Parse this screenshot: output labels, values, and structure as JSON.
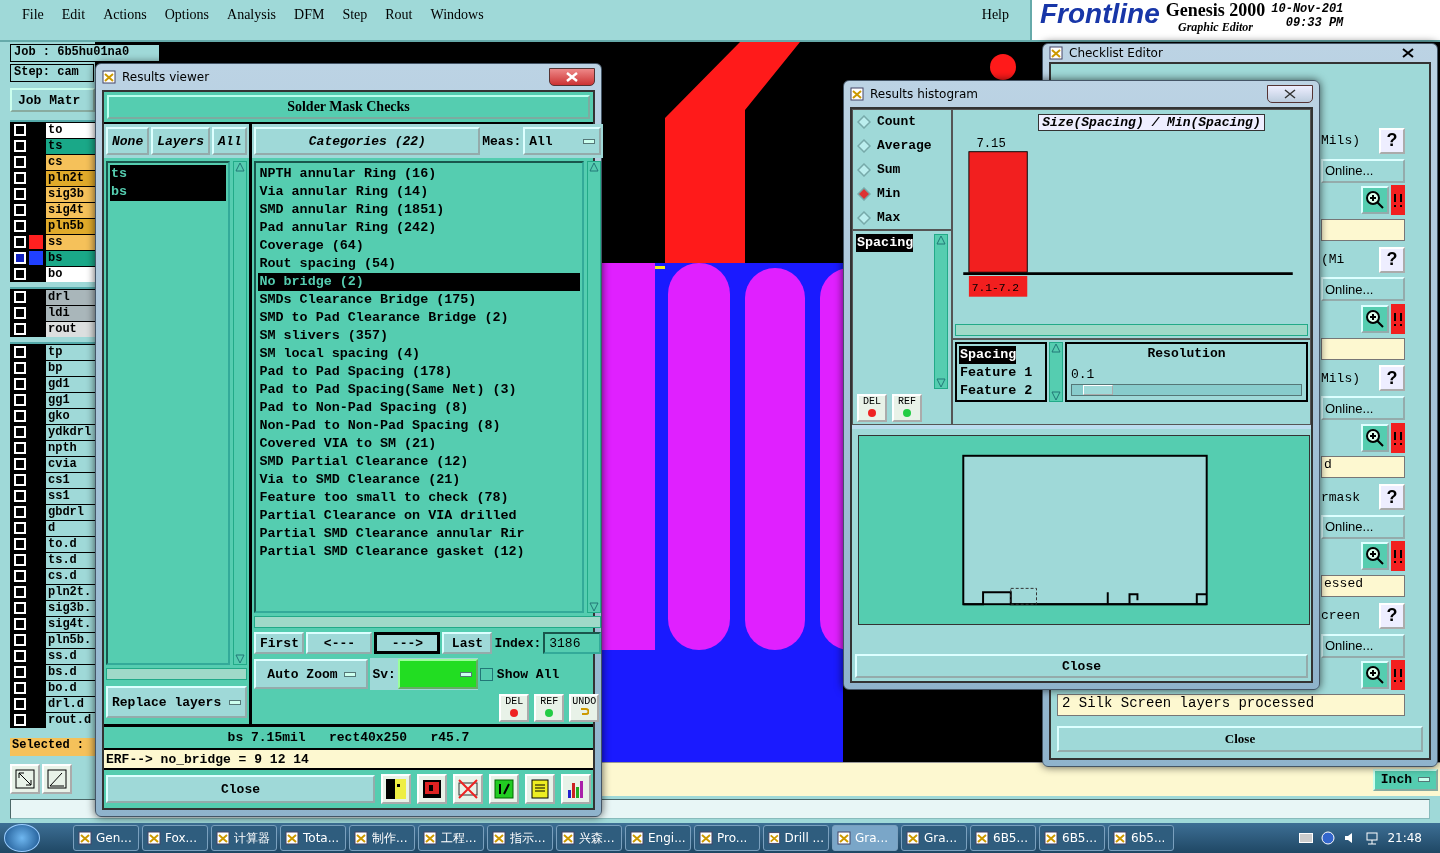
{
  "menubar": {
    "items": [
      "File",
      "Edit",
      "Actions",
      "Options",
      "Analysis",
      "DFM",
      "Step",
      "Rout",
      "Windows"
    ],
    "help": "Help"
  },
  "brand": {
    "logo": "Frontline",
    "product": "Genesis 2000",
    "subtitle": "Graphic Editor",
    "date": "10-Nov-201",
    "time": "09:33 PM"
  },
  "job": {
    "job": "Job : 6b5hu01na0",
    "step": "Step: cam",
    "matrix_button": "Job Matr"
  },
  "layer_groups": [
    [
      {
        "name": "to",
        "kind": "silk",
        "active": false
      },
      {
        "name": "ts",
        "kind": "mask",
        "active": false
      },
      {
        "name": "cs",
        "kind": "signal",
        "active": false
      },
      {
        "name": "pln2t",
        "kind": "power",
        "active": false
      },
      {
        "name": "sig3b",
        "kind": "signal",
        "active": false
      },
      {
        "name": "sig4t",
        "kind": "signal",
        "active": false
      },
      {
        "name": "pln5b",
        "kind": "power",
        "active": false
      },
      {
        "name": "ss",
        "kind": "signal",
        "color": "#ff2020",
        "active": false
      },
      {
        "name": "bs",
        "kind": "mask",
        "color": "#2040ff",
        "active": true
      },
      {
        "name": "bo",
        "kind": "silk",
        "active": false
      }
    ],
    [
      {
        "name": "drl",
        "kind": "drill",
        "active": false
      },
      {
        "name": "ldi",
        "kind": "drill",
        "active": false
      },
      {
        "name": "rout",
        "kind": "rout",
        "active": false
      }
    ],
    [
      {
        "name": "tp",
        "kind": "document",
        "active": false
      },
      {
        "name": "bp",
        "kind": "document",
        "active": false
      },
      {
        "name": "gd1",
        "kind": "document",
        "active": false
      },
      {
        "name": "gg1",
        "kind": "document",
        "active": false
      },
      {
        "name": "gko",
        "kind": "document",
        "active": false
      },
      {
        "name": "ydkdrl",
        "kind": "document",
        "active": false
      },
      {
        "name": "npth",
        "kind": "document",
        "active": false
      },
      {
        "name": "cvia",
        "kind": "document",
        "active": false
      },
      {
        "name": "cs1",
        "kind": "document",
        "active": false
      },
      {
        "name": "ss1",
        "kind": "document",
        "active": false
      },
      {
        "name": "gbdrl",
        "kind": "document",
        "active": false
      },
      {
        "name": "d",
        "kind": "document",
        "active": false
      },
      {
        "name": "to.d",
        "kind": "document",
        "active": false
      },
      {
        "name": "ts.d",
        "kind": "document",
        "active": false
      },
      {
        "name": "cs.d",
        "kind": "document",
        "active": false
      },
      {
        "name": "pln2t.",
        "kind": "document",
        "active": false
      },
      {
        "name": "sig3b.",
        "kind": "document",
        "active": false
      },
      {
        "name": "sig4t.",
        "kind": "document",
        "active": false
      },
      {
        "name": "pln5b.",
        "kind": "document",
        "active": false
      },
      {
        "name": "ss.d",
        "kind": "document",
        "active": false
      },
      {
        "name": "bs.d",
        "kind": "document",
        "active": false
      },
      {
        "name": "bo.d",
        "kind": "document",
        "active": false
      },
      {
        "name": "drl.d",
        "kind": "document",
        "active": false
      },
      {
        "name": "rout.d",
        "kind": "document",
        "active": false
      }
    ]
  ],
  "selected_label": "Selected :",
  "results_viewer": {
    "title": "Results viewer",
    "header": "Solder Mask Checks",
    "none_button": "None",
    "layers_label": "Layers",
    "all_button": "All",
    "categories_label": "Categories (22)",
    "meas_label": "Meas:",
    "meas_value": "All",
    "layers": [
      {
        "name": "ts",
        "selected": true
      },
      {
        "name": "bs",
        "selected": true
      }
    ],
    "categories": [
      {
        "label": "NPTH annular Ring (16)",
        "selected": false
      },
      {
        "label": "Via annular Ring (14)",
        "selected": false
      },
      {
        "label": "SMD annular Ring (1851)",
        "selected": false
      },
      {
        "label": "Pad annular Ring (242)",
        "selected": false
      },
      {
        "label": "Coverage (64)",
        "selected": false
      },
      {
        "label": "Rout spacing (54)",
        "selected": false
      },
      {
        "label": "No bridge (2)",
        "selected": true
      },
      {
        "label": "SMDs Clearance Bridge (175)",
        "selected": false
      },
      {
        "label": "SMD to Pad Clearance Bridge (2)",
        "selected": false
      },
      {
        "label": "SM slivers (357)",
        "selected": false
      },
      {
        "label": "SM local spacing (4)",
        "selected": false
      },
      {
        "label": "Pad to Pad Spacing (178)",
        "selected": false
      },
      {
        "label": "Pad to Pad Spacing(Same Net) (3)",
        "selected": false
      },
      {
        "label": "Pad to Non-Pad Spacing (8)",
        "selected": false
      },
      {
        "label": "Non-Pad to Non-Pad Spacing (8)",
        "selected": false
      },
      {
        "label": "Covered VIA to SM (21)",
        "selected": false
      },
      {
        "label": "SMD Partial Clearance (12)",
        "selected": false
      },
      {
        "label": "Via to SMD Clearance (21)",
        "selected": false
      },
      {
        "label": "Feature too small to check (78)",
        "selected": false
      },
      {
        "label": "Partial Clearance on VIA drilled",
        "selected": false
      },
      {
        "label": "Partial SMD Clearance annular Rir",
        "selected": false
      },
      {
        "label": "Partial SMD Clearance gasket (12)",
        "selected": false
      }
    ],
    "nav_buttons": [
      {
        "label": "First",
        "selected": false
      },
      {
        "label": "<---",
        "selected": false
      },
      {
        "label": "--->",
        "selected": true
      },
      {
        "label": "Last",
        "selected": false
      }
    ],
    "index_label": "Index:",
    "index_value": "3186",
    "zoom_mode": "Auto Zoom",
    "sv_label": "Sv:",
    "show_all": {
      "label": "Show All",
      "checked": false
    },
    "replace_mode": "Replace layers",
    "action_buttons": [
      {
        "label": "DEL",
        "kind": "del"
      },
      {
        "label": "REF",
        "kind": "ref"
      },
      {
        "label": "UNDO",
        "kind": "undo"
      }
    ],
    "measure": "bs 7.15mil   rect40x250   r45.7",
    "erf": "ERF--> no_bridge = 9 12 14",
    "close": "Close",
    "tools": [
      {
        "kind": "figure"
      },
      {
        "kind": "monitor"
      },
      {
        "kind": "erf-off"
      },
      {
        "kind": "half"
      },
      {
        "kind": "notes"
      },
      {
        "kind": "bars"
      }
    ]
  },
  "histogram": {
    "title": "Results histogram",
    "modes": [
      {
        "label": "Count",
        "selected": false
      },
      {
        "label": "Average",
        "selected": false
      },
      {
        "label": "Sum",
        "selected": false
      },
      {
        "label": "Min",
        "selected": true
      },
      {
        "label": "Max",
        "selected": false
      }
    ],
    "measures": [
      {
        "label": "Spacing",
        "selected": true
      }
    ],
    "action_buttons": [
      {
        "label": "DEL",
        "kind": "del"
      },
      {
        "label": "REF",
        "kind": "ref"
      }
    ],
    "chart_title": "Size(Spacing) / Min(Spacing)",
    "bins": [
      {
        "value_label": "7.15",
        "range": "7.1-7.2"
      }
    ],
    "fields": [
      {
        "label": "Spacing",
        "selected": true
      },
      {
        "label": "Feature 1",
        "selected": false
      },
      {
        "label": "Feature 2",
        "selected": false
      }
    ],
    "resolution_label": "Resolution",
    "resolution_value": "0.1",
    "resolution": {
      "level": 0.05
    },
    "close": "Close"
  },
  "checklist": {
    "title": "Checklist Editor",
    "rows": [
      {
        "kind": "question",
        "text": "Mils)",
        "button": "?"
      },
      {
        "kind": "online",
        "text": "Online..."
      },
      {
        "kind": "zoom"
      },
      {
        "kind": "field",
        "text": ""
      },
      {
        "kind": "question",
        "text": "(Mi",
        "button": "?"
      },
      {
        "kind": "online",
        "text": "Online..."
      },
      {
        "kind": "zoom"
      },
      {
        "kind": "field",
        "text": ""
      },
      {
        "kind": "question",
        "text": "Mils)",
        "button": "?"
      },
      {
        "kind": "online",
        "text": "Online..."
      },
      {
        "kind": "zoom"
      },
      {
        "kind": "field",
        "text": "d"
      },
      {
        "kind": "question",
        "text": "rmask",
        "button": "?"
      },
      {
        "kind": "online",
        "text": "Online..."
      },
      {
        "kind": "zoom"
      },
      {
        "kind": "field",
        "text": "essed"
      },
      {
        "kind": "question",
        "text": "creen",
        "button": "?"
      },
      {
        "kind": "online",
        "text": "Online..."
      },
      {
        "kind": "zoom"
      }
    ],
    "message": "2 Silk Screen layers processed",
    "close": "Close"
  },
  "status_bar": {
    "units": "Inch"
  },
  "taskbar": {
    "items": [
      {
        "label": "Gen...",
        "selected": false
      },
      {
        "label": "Fox...",
        "selected": false
      },
      {
        "label": "计算器",
        "selected": false
      },
      {
        "label": "Tota...",
        "selected": false
      },
      {
        "label": "制作...",
        "selected": false
      },
      {
        "label": "工程...",
        "selected": false
      },
      {
        "label": "指示...",
        "selected": false
      },
      {
        "label": "兴森...",
        "selected": false
      },
      {
        "label": "Engi...",
        "selected": false
      },
      {
        "label": "Pro...",
        "selected": false
      },
      {
        "label": "Drill ...",
        "selected": false
      },
      {
        "label": "Gra...",
        "selected": true
      },
      {
        "label": "Gra...",
        "selected": false
      },
      {
        "label": "6B5...",
        "selected": false
      },
      {
        "label": "6B5...",
        "selected": false
      },
      {
        "label": "6b5...",
        "selected": false
      }
    ],
    "clock": "21:48"
  }
}
